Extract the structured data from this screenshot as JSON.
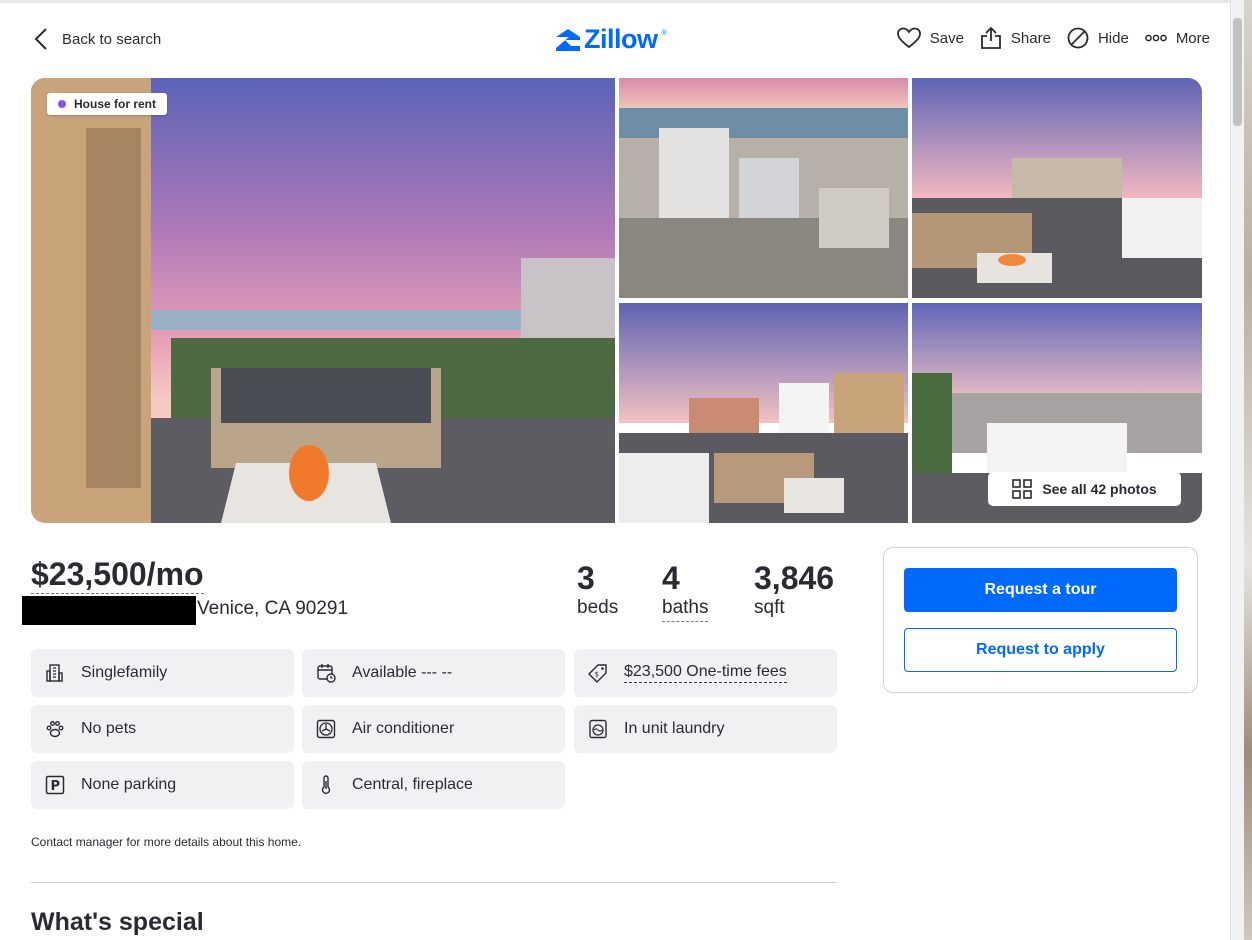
{
  "header": {
    "back_label": "Back to search",
    "logo_text": "Zillow",
    "logo_tm": "®",
    "actions": [
      {
        "label": "Save",
        "icon": "heart-icon"
      },
      {
        "label": "Share",
        "icon": "share-icon"
      },
      {
        "label": "Hide",
        "icon": "hide-icon"
      },
      {
        "label": "More",
        "icon": "more-icon"
      }
    ]
  },
  "gallery": {
    "badge": "House for rent",
    "badge_color": "#8a4ff0",
    "see_all_label": "See all 42 photos"
  },
  "summary": {
    "price": "$23,500/mo",
    "address": "Venice, CA 90291",
    "beds": {
      "value": "3",
      "label": "beds"
    },
    "baths": {
      "value": "4",
      "label": "baths"
    },
    "sqft": {
      "value": "3,846",
      "label": "sqft"
    }
  },
  "facts": [
    {
      "text": "Singlefamily",
      "icon": "building-icon"
    },
    {
      "text": "Available --- --",
      "icon": "calendar-icon"
    },
    {
      "text": "$23,500 One-time fees",
      "icon": "price-tag-icon"
    },
    {
      "text": "No pets",
      "icon": "paw-icon"
    },
    {
      "text": "Air conditioner",
      "icon": "fan-icon"
    },
    {
      "text": "In unit laundry",
      "icon": "washer-icon"
    },
    {
      "text": "None parking",
      "icon": "parking-icon"
    },
    {
      "text": "Central, fireplace",
      "icon": "thermometer-icon"
    }
  ],
  "contact_note": "Contact manager for more details about this home.",
  "section_title": "What's special",
  "card": {
    "primary_label": "Request a tour",
    "secondary_label": "Request to apply"
  },
  "colors": {
    "brand": "#006aff",
    "text": "#2a2a33",
    "fact_bg": "#f1f1f4"
  }
}
